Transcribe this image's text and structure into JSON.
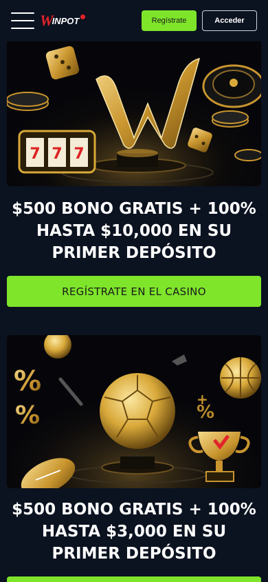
{
  "header": {
    "logo_main": "W",
    "logo_rest": "INPOT",
    "register_label": "Regístrate",
    "login_label": "Acceder"
  },
  "promos": [
    {
      "title": "$500 BONO GRATIS + 100% HASTA $10,000 EN SU PRIMER DEPÓSITO",
      "cta_label": "REGÍSTRATE EN EL CASINO",
      "image": "casino-banner"
    },
    {
      "title": "$500 BONO GRATIS + 100% HASTA $3,000 EN SU PRIMER DEPÓSITO",
      "image": "sports-banner"
    }
  ],
  "colors": {
    "accent_green": "#7ee52b",
    "background": "#0b1220",
    "logo_red": "#e2232a",
    "gold": "#d9a93a"
  }
}
